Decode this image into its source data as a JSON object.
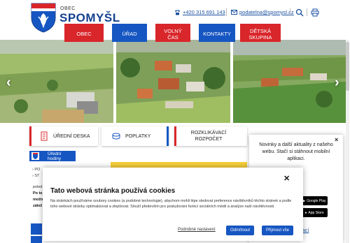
{
  "header": {
    "brand_small": "OBEC",
    "brand_big": "SPOMYŠL",
    "phone": "+420 315 691 143",
    "email": "podatelna@spomysl.cz"
  },
  "nav": [
    {
      "label": "OBEC"
    },
    {
      "label": "ÚŘAD"
    },
    {
      "label": "VOLNÝ ČAS"
    },
    {
      "label": "KONTAKTY"
    },
    {
      "label": "DĚTSKÁ SKUPINA"
    }
  ],
  "quick_links": [
    {
      "label": "ÚŘEDNÍ DESKA"
    },
    {
      "label": "POPLATKY"
    },
    {
      "label": "ROZKLIKÁVACÍ ROZPOČET"
    }
  ],
  "sidebar": {
    "heading": "Úřední hodiny",
    "item1": "PO",
    "item2": "ST",
    "line1": "poled",
    "line2": "Po te",
    "line3": "možn",
    "line4": "zálež"
  },
  "app_popup": {
    "text": "Novinky a další aktuality z našeho webu. Stačí si stáhnout mobilní aplikaci.",
    "google": "Google Play",
    "apple": "App Store",
    "link": "ací"
  },
  "cookie": {
    "title": "Tato webová stránka používá cookies",
    "body": "Na stránkách používáme soubory cookies (a podobné technologie), abychom mohli lépe sledovat preference návštěvníků těchto stránek a podle toho webové stránky optimalizovat a zlepšovat. Slouží především pro poskytování funkcí sociálních médií a analýze naší návštěvnosti.",
    "settings": "Podrobné nastavení",
    "reject": "Odmítnout",
    "accept": "Přijmout vše"
  },
  "colors": {
    "brand_blue": "#1656c2",
    "brand_red": "#d9262b",
    "accent_yellow": "#f6cf3a"
  }
}
